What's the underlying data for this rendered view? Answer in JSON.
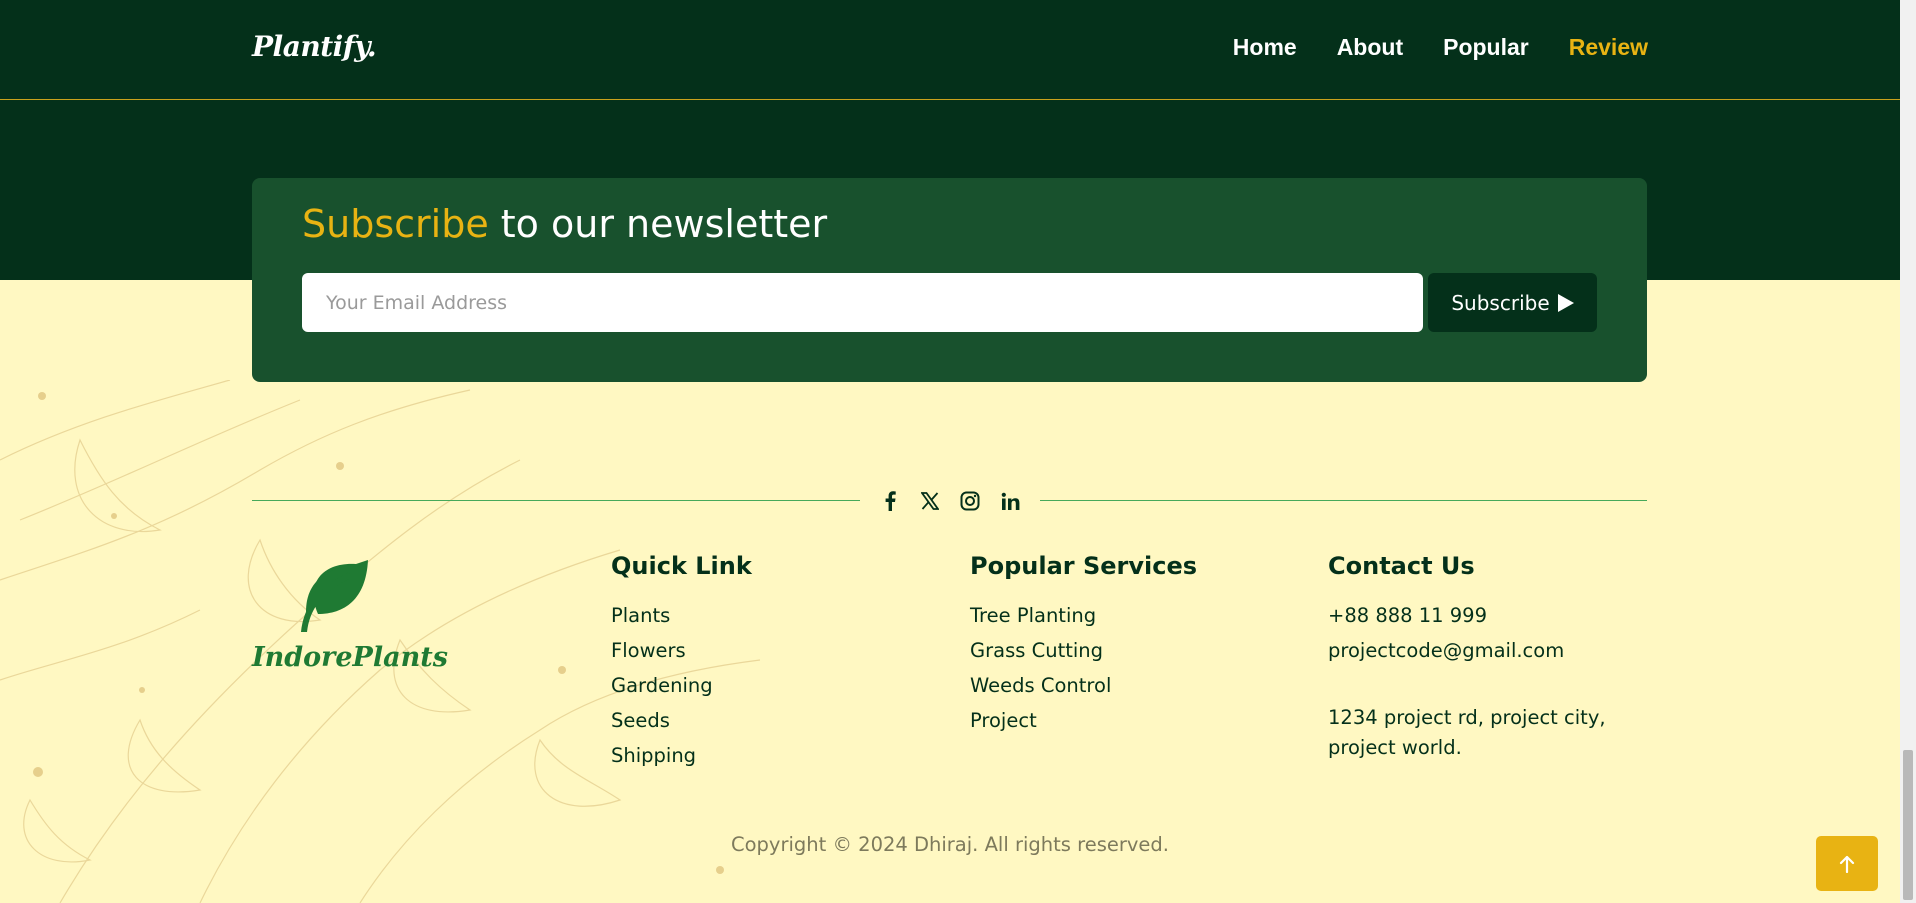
{
  "header": {
    "logo": "Plantify.",
    "nav": [
      {
        "label": "Home",
        "active": false
      },
      {
        "label": "About",
        "active": false
      },
      {
        "label": "Popular",
        "active": false
      },
      {
        "label": "Review",
        "active": true
      }
    ]
  },
  "newsletter": {
    "title_highlight": "Subscribe",
    "title_rest": " to our newsletter",
    "email_placeholder": "Your Email Address",
    "button_label": "Subscribe"
  },
  "social": {
    "icons": [
      "facebook-icon",
      "x-twitter-icon",
      "instagram-icon",
      "linkedin-icon"
    ]
  },
  "brand": {
    "name": "IndorePlants",
    "icon": "leaf-icon"
  },
  "quick_links": {
    "title": "Quick Link",
    "items": [
      "Plants",
      "Flowers",
      "Gardening",
      "Seeds",
      "Shipping"
    ]
  },
  "services": {
    "title": "Popular Services",
    "items": [
      "Tree Planting",
      "Grass Cutting",
      "Weeds Control",
      "Project"
    ]
  },
  "contact": {
    "title": "Contact Us",
    "phone": "+88 888 11 999",
    "email": "projectcode@gmail.com",
    "address": "1234 project rd, project city, project world."
  },
  "copyright": "Copyright © 2024 Dhiraj. All rights reserved.",
  "colors": {
    "dark_green": "#04301a",
    "card_green": "#18512d",
    "accent_gold": "#e8b313",
    "cream": "#fff8c2",
    "brand_green": "#1f7a33"
  }
}
